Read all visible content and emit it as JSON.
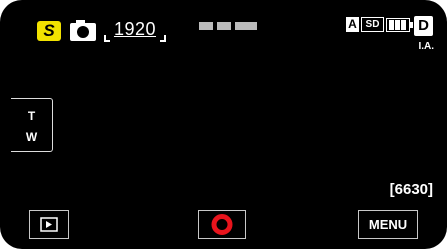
{
  "status_bar": {
    "mode_badge": "S",
    "resolution": "1920",
    "record_mode": "A",
    "media": "SD",
    "mode_letter": "D",
    "intelligent_auto": "I.A."
  },
  "zoom": {
    "tele": "T",
    "wide": "W"
  },
  "remaining_shots": "[6630]",
  "buttons": {
    "menu": "MENU"
  },
  "colors": {
    "background": "#000000",
    "mode_badge": "#f2e200",
    "record_button": "#e8141c",
    "text": "#ffffff"
  },
  "icons": {
    "still_camera": "camera-icon",
    "battery": "battery-icon",
    "playback": "play-icon",
    "record": "record-ring-icon"
  }
}
